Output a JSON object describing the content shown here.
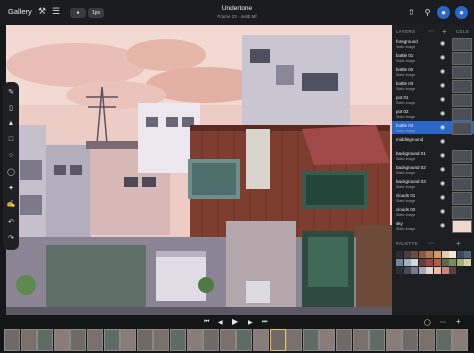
{
  "topbar": {
    "gallery_label": "Gallery",
    "brush_size_label": "1px",
    "title": "Undertone",
    "subtitle": "Frame 23 · 4x8b Mf"
  },
  "tools": [
    "brush-icon",
    "eraser-icon",
    "fill-icon",
    "select-icon",
    "color-picker-icon",
    "shape-icon",
    "lasso-icon",
    "eyedropper-icon",
    "undo-icon",
    "redo-icon"
  ],
  "panel": {
    "layers_label": "LAYERS",
    "cels_label": "CELS",
    "palette_label": "PALETTE",
    "layers": [
      {
        "name": "foreground",
        "sub": "Static image"
      },
      {
        "name": "bottle 01",
        "sub": "Static image"
      },
      {
        "name": "bottle 02",
        "sub": "Static image"
      },
      {
        "name": "bottle 03",
        "sub": "Static image"
      },
      {
        "name": "pot 01",
        "sub": "Static image"
      },
      {
        "name": "pot 02",
        "sub": "Static image"
      },
      {
        "name": "bottle 04",
        "sub": "Static image"
      },
      {
        "name": "middleground",
        "sub": ""
      },
      {
        "name": "background 01",
        "sub": "Static image"
      },
      {
        "name": "background 02",
        "sub": "Static image"
      },
      {
        "name": "background 03",
        "sub": "Static image"
      },
      {
        "name": "clouds 01",
        "sub": "Static image"
      },
      {
        "name": "clouds 02",
        "sub": "Static image"
      },
      {
        "name": "sky",
        "sub": "Static image"
      }
    ],
    "selected_layer": "bottle 04",
    "palette": [
      "#2d2a34",
      "#4a3b46",
      "#6d4a42",
      "#8a5a40",
      "#b07850",
      "#d49a6a",
      "#e8c8a8",
      "#f2e6d8",
      "#3a4a5a",
      "#4e6478",
      "#6f8798",
      "#9fb2c0",
      "#cfd8de",
      "#6a3a36",
      "#8e4a3e",
      "#b65a4a",
      "#5a6a4a",
      "#7a8a5a",
      "#a8b07a",
      "#d8d0a0",
      "#2a2f3a",
      "#474a58",
      "#7a7888",
      "#a8a4b2",
      "#e8d0d0",
      "#f0b8a8",
      "#c88880",
      "#5a4040"
    ]
  },
  "timeline": {
    "controls": [
      "skip-back-icon",
      "step-back-icon",
      "play-icon",
      "step-forward-icon",
      "skip-forward-icon"
    ],
    "frame_count": 28,
    "current_frame": 16
  }
}
